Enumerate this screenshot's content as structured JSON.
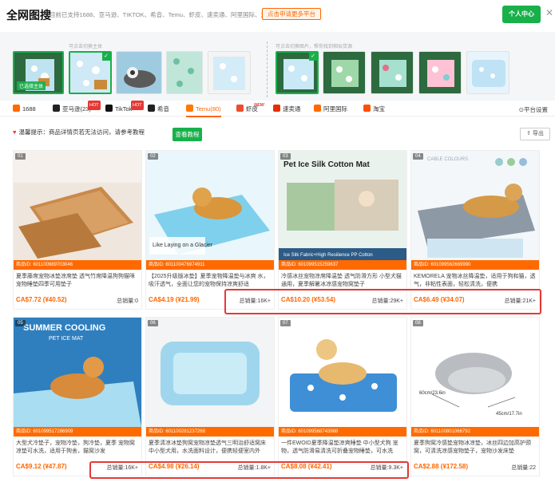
{
  "header": {
    "logo": "全网图搜",
    "subtitle": "目前已支持1688、亚马逊、TIKTOK、希音、Temu、虾皮、速卖通、阿里国际、淘宝",
    "apply_label": "点击申请更多平台",
    "user_center_label": "个人中心",
    "close_glyph": "✕"
  },
  "upload": {
    "left_hint": "可点击切换主体",
    "right_hint": "可点击切换图片，帮你找到相似货源",
    "selected_caption": "已选择主体",
    "check_glyph": "✓"
  },
  "tabs": [
    {
      "label": "1688",
      "color": "#ff6a00"
    },
    {
      "label": "亚马逊(23)",
      "color": "#222222",
      "badge": "HOT"
    },
    {
      "label": "TikTok",
      "color": "#111111",
      "badge": "HOT"
    },
    {
      "label": "希音",
      "color": "#222222"
    },
    {
      "label": "Temu(80)",
      "color": "#ff7a00",
      "active": true
    },
    {
      "label": "虾皮",
      "color": "#ee4d2d",
      "badge": "NEW"
    },
    {
      "label": "速卖通",
      "color": "#e62e04"
    },
    {
      "label": "阿里国际",
      "color": "#ff6a00"
    },
    {
      "label": "淘宝",
      "color": "#ff5000"
    }
  ],
  "platform_settings": "⊙平台设置",
  "notice": {
    "heart": "♥",
    "text": "温馨提示：商品详情页若无法访问，请参考教程",
    "tutorial_label": "查看教程",
    "export_label": "⇪ 导出"
  },
  "products": [
    {
      "num": "01",
      "id": "商品ID: 601100989703046",
      "title": "夏季藤席宠物冰垫凉席垫 透气竹席降温狗狗猫咪 宠物睡垫四季可用垫子",
      "price": "CA$7.72 (¥40.52)",
      "sales": "总销量:0"
    },
    {
      "num": "02",
      "id": "商品ID: 601100476974911",
      "title": "【2025升级版冰垫】夏季宠物降温垫与冰爽 水，吸汗透气，全面让您的宠物保持凉爽舒适",
      "price": "CA$4.19 (¥21.99)",
      "sales": "总销量:16K+"
    },
    {
      "num": "03",
      "id": "商品ID: 601099515259637",
      "title": "冷感冰丝宠物凉席降温垫 透气防滑方形 小型犬猫通用，夏季解暑冰凉感宠物窝垫子",
      "price": "CA$10.20 (¥53.54)",
      "sales": "总销量:29K+"
    },
    {
      "num": "04",
      "id": "商品ID: 601099562669990",
      "title": "KEMORELA 宠物冰丝降温垫，适用于狗和猫，透气，非粘性表面，轻松清洗，便携",
      "price": "CA$6.49 (¥34.07)",
      "sales": "总销量:21K+"
    },
    {
      "num": "05",
      "id": "商品ID: 601099517286909",
      "title": "大型犬冷垫子，宠物冷垫，狗冷垫，夏季 宠物窝凉垫可水洗，适用于狗舍，猫窝沙发",
      "price": "CA$9.12 (¥47.87)",
      "sales": "总销量:16K+"
    },
    {
      "num": "06",
      "id": "商品ID: 601100281237268",
      "title": "夏季清凉冰垫狗窝宠物凉垫透气三明治舒适窝床 中小型犬用，水洗面料设计，便携轻便室内外",
      "price": "CA$4.98 (¥26.14)",
      "sales": "总销量:1.8K+"
    },
    {
      "num": "07",
      "id": "商品ID: 601099568743988",
      "title": "一件EWOID夏季降温垫凉爽睡垫 中小型犬狗 宠物，透气防滑易清洗可折叠宠物睡垫，可水洗",
      "price": "CA$8.08 (¥42.41)",
      "sales": "总销量:9.3K+"
    },
    {
      "num": "08",
      "id": "商品ID: 601100801066792",
      "title": "夏季狗窝冷感垫宠物冰凉垫，冰丝四边加高护颈 窝，可清洗凉感宠物垫子，宠物沙发床垫",
      "price": "CA$2.88 (¥172.58)",
      "sales": "总销量:22"
    }
  ],
  "image_labels": {
    "p3": "Pet Ice Silk Cotton Mat",
    "p3_sub": "Ice Silk Fabric+High Resilience PP Cotton",
    "p2": "Like Laying on a Glacier",
    "p4": "CABLE COLOURS",
    "p5": "SUMMER COOLING",
    "p5_sub": "PET ICE MAT",
    "p8_w": "60cm/23.6in",
    "p8_d": "45cm/17.7in"
  },
  "colors": {
    "accent": "#ff6a00",
    "green": "#18b04a",
    "highlight": "#e53935"
  }
}
